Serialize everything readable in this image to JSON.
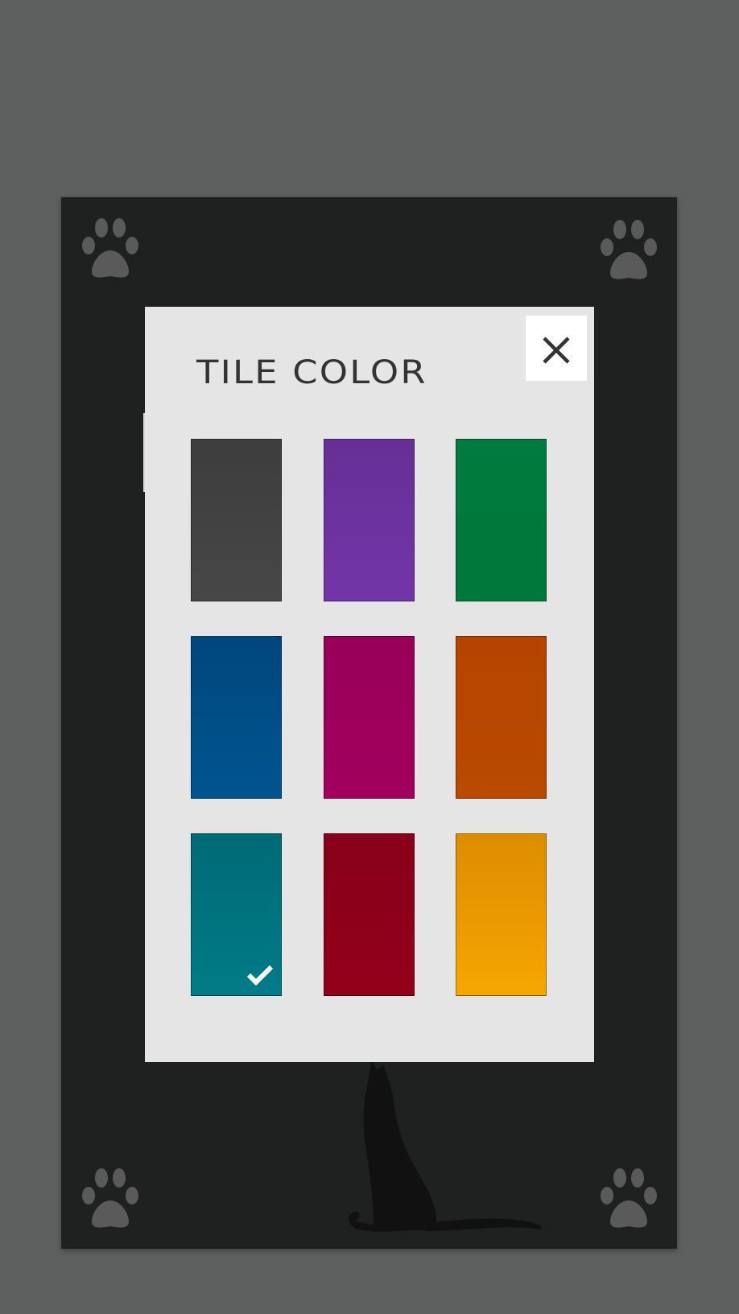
{
  "dialog": {
    "title": "TILE COLOR",
    "close_label": "X"
  },
  "swatches": [
    {
      "name": "dark-gray",
      "top": "#3d3d3d",
      "bottom": "#474747",
      "selected": false
    },
    {
      "name": "purple",
      "top": "#662f96",
      "bottom": "#7335a8",
      "selected": false
    },
    {
      "name": "green",
      "top": "#007a3e",
      "bottom": "#00773b",
      "selected": false
    },
    {
      "name": "blue",
      "top": "#00467e",
      "bottom": "#00558f",
      "selected": false
    },
    {
      "name": "magenta",
      "top": "#980058",
      "bottom": "#a2005e",
      "selected": false
    },
    {
      "name": "orange",
      "top": "#b54400",
      "bottom": "#b94a00",
      "selected": false
    },
    {
      "name": "teal",
      "top": "#006a76",
      "bottom": "#007c88",
      "selected": true
    },
    {
      "name": "red",
      "top": "#88001b",
      "bottom": "#930019",
      "selected": false
    },
    {
      "name": "amber",
      "top": "#dc8d00",
      "bottom": "#f7a600",
      "selected": false
    }
  ],
  "icons": {
    "corner": "paw-icon",
    "background": "cat-silhouette",
    "close": "close-icon",
    "selected": "checkmark-icon"
  },
  "colors": {
    "backdrop": "#5e5f5f",
    "board": "#1f2020",
    "dialog": "#e5e5e5",
    "title_text": "#333333",
    "paw": "#5a5a5a"
  }
}
